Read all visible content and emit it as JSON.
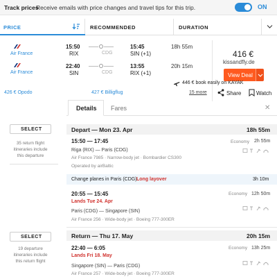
{
  "banner": {
    "title": "Track prices",
    "description": "Receive emails with price changes and travel tips for this trip.",
    "toggle_label": "ON"
  },
  "sort_tabs": {
    "price": "PRICE",
    "recommended": "RECOMMENDED",
    "duration": "DURATION"
  },
  "result": {
    "flights": [
      {
        "airline": "Air France",
        "depart_time": "15:50",
        "depart_code": "RIX",
        "stop": "CDG",
        "arrive_time": "15:45",
        "arrive_code": "SIN (+1)",
        "duration": "18h 55m"
      },
      {
        "airline": "Air France",
        "depart_time": "22:40",
        "depart_code": "SIN",
        "stop": "CDG",
        "arrive_time": "13:55",
        "arrive_code": "RIX (+1)",
        "duration": "20h 15m"
      }
    ],
    "price": "416 €",
    "vendor": "kissandfly.de",
    "view_deal": "View Deal",
    "kayak_offer": "446 € book easily on KAYAK",
    "providers": [
      "426 € Opodo",
      "427 € Billigflug"
    ],
    "more_link": "15 more",
    "share": "Share",
    "watch": "Watch"
  },
  "detail_tabs": {
    "details": "Details",
    "fares": "Fares"
  },
  "outbound": {
    "select": "SELECT",
    "note": "35 return flight itineraries include this departure",
    "header": "Depart — Mon 23. Apr",
    "total": "18h 55m",
    "seg1": {
      "time": "15:50 — 17:45",
      "route": "Riga (RIX) — Paris (CDG)",
      "info": "Air France 7985  ·  Narrow-body jet  ·  Bombardier CS300",
      "operated": "Operated by airBaltic",
      "class": "Economy",
      "duration": "2h 55m"
    },
    "layover": {
      "text": "Change planes in Paris (CDG)",
      "warn": "Long layover",
      "duration": "3h 10m"
    },
    "seg2": {
      "time": "20:55 — 15:45",
      "lands": "Lands Tue 24. Apr",
      "route": "Paris (CDG) — Singapore (SIN)",
      "info": "Air France 256  ·  Wide-body jet  ·  Boeing 777-300ER",
      "class": "Economy",
      "duration": "12h 50m"
    }
  },
  "return": {
    "select": "SELECT",
    "note": "19 departure itineraries include this return flight",
    "header": "Return — Thu 17. May",
    "total": "20h 15m",
    "seg1": {
      "time": "22:40 — 6:05",
      "lands": "Lands Fri 18. May",
      "route": "Singapore (SIN) — Paris (CDG)",
      "info": "Air France 257  ·  Wide-body jet  ·  Boeing 777-300ER",
      "class": "Economy",
      "duration": "13h 25m"
    }
  },
  "colors": {
    "accent": "#2a8bd8",
    "deal": "#ff5a1f",
    "warning": "#d0312d"
  }
}
